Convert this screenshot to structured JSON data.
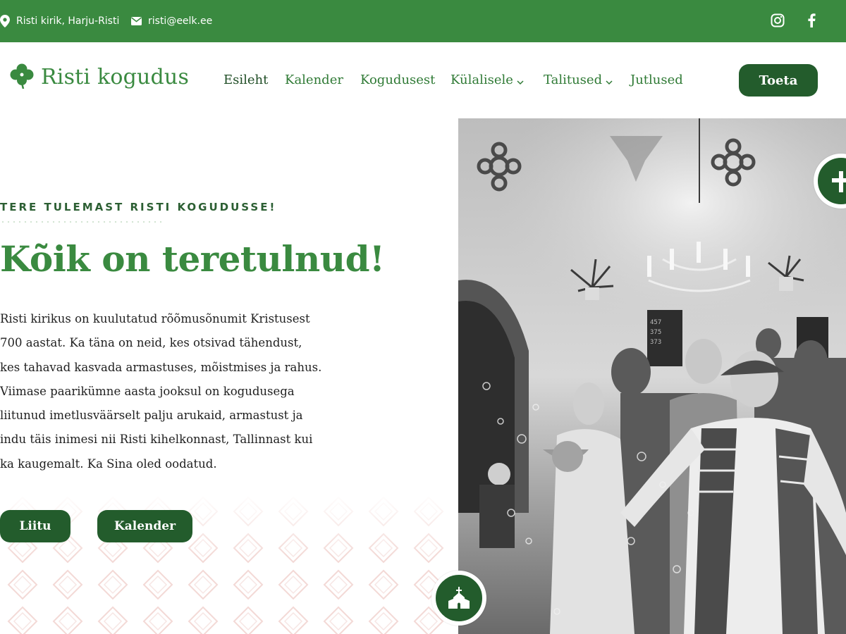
{
  "topbar": {
    "location_icon": "map-pin-icon",
    "location": "Risti kirik, Harju-Risti",
    "email_icon": "envelope-icon",
    "email": "risti@eelk.ee",
    "social": [
      {
        "icon": "instagram-icon"
      },
      {
        "icon": "facebook-icon"
      }
    ]
  },
  "header": {
    "logo_icon": "clover-icon",
    "logo_text": "Risti kogudus",
    "nav": [
      {
        "label": "Esileht",
        "active": true
      },
      {
        "label": "Kalender"
      },
      {
        "label": "Kogudusest"
      },
      {
        "label": "Külalisele",
        "dropdown": true
      },
      {
        "label": "Talitused",
        "dropdown": true
      },
      {
        "label": "Jutlused"
      }
    ],
    "cta_label": "Toeta"
  },
  "hero": {
    "eyebrow": "TERE TULEMAST RISTI KOGUDUSSE!",
    "title": "Kõik on teretulnud!",
    "lines": [
      "Risti kirikus on kuulutatud rõõmusõnumit Kristusest",
      "700 aastat. Ka täna on neid, kes otsivad tähendust,",
      "kes tahavad kasvada armastuses, mõistmises ja rahus.",
      "Viimase paarikümne aasta jooksul on kogudusega",
      "liitunud imetlusväärselt palju arukaid, armastust ja",
      "indu täis inimesi nii Risti kihelkonnast, Tallinnast kui",
      "ka kaugemalt. Ka Sina oled oodatud."
    ],
    "buttons": {
      "join": "Liitu",
      "calendar": "Kalender"
    }
  },
  "photo": {
    "board_numbers": [
      "457",
      "375",
      "373"
    ]
  },
  "floating": {
    "church_icon": "church-icon",
    "cross_icon": "cross-icon"
  },
  "colors": {
    "brand_green": "#3a8a40",
    "dark_green": "#235c2c",
    "pattern_pink": "#f3d9d6"
  }
}
